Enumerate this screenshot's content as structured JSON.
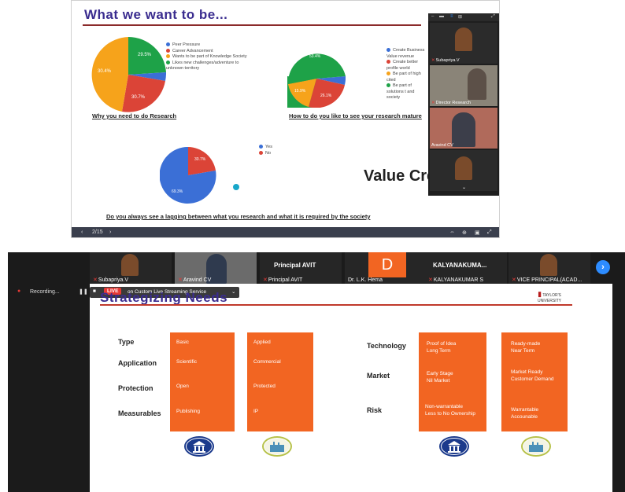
{
  "top_slide": {
    "title": "What we want to be...",
    "page_indicator": "2/15",
    "value_text": "Value Cre",
    "pie1": {
      "labels": [
        "29.5%",
        "30.4%",
        "30.7%"
      ],
      "legend": [
        "Peer Pressure",
        "Career Advancement",
        "Wants to be part of Knowledge Society",
        "Likes new challenges/adventure to unknown territory"
      ],
      "caption": "Why you need to do Research"
    },
    "pie2": {
      "labels": [
        "53.4%",
        "15.9%",
        "26.1%"
      ],
      "legend": [
        "Create Business Value revenue",
        "Create better profile world",
        "Be part of high cited",
        "Be part of solutions t and society"
      ],
      "caption": "How to do you like to see your research mature"
    },
    "pie3": {
      "labels": [
        "30.7%",
        "69.3%"
      ],
      "legend": [
        "Yes",
        "No"
      ],
      "caption": "Do you always see a lagging between what you research and what it is required by the society"
    },
    "colors": {
      "blue": "#3b6fd6",
      "red": "#db4437",
      "orange": "#f6a31b",
      "green": "#1ea248"
    }
  },
  "top_panel": {
    "participants": [
      "Subapriya.V",
      "Director Research",
      "Aravind CV",
      ""
    ]
  },
  "bottom_strip": {
    "participants": [
      "Subapriya.V",
      "Aravind CV",
      "Principal AVIT",
      "Dr. L.K. Hema",
      "KALYANAKUMAR S",
      "VICE PRINCIPAL(ACAD..."
    ],
    "principal_big": "Principal AVIT",
    "kalyan_big": "KALYANAKUMA...",
    "hema_initial": "D"
  },
  "recording": {
    "label": "Recording...",
    "live": "LIVE",
    "stream_text": "on Custom Live Streaming Service"
  },
  "slide2": {
    "title": "Strategizing Needs",
    "logo_text": "TAYLOR'S UNIVERSITY",
    "left_labels": [
      "Type",
      "Application",
      "Protection",
      "Measurables"
    ],
    "col1": [
      "Basic",
      "Scientific",
      "Open",
      "Publishing"
    ],
    "col2": [
      "Applied",
      "Commercial",
      "Protected",
      "IP"
    ],
    "right_labels": [
      "Technology",
      "Market",
      "Risk"
    ],
    "col3": [
      "Proof of Idea\nLong Term",
      "Early Stage\nNil Market",
      "Non-warrantable\nLess to No Ownership"
    ],
    "col4": [
      "Ready-made\nNear Term",
      "Market Ready\nCustomer Demand",
      "Warrantable\nAccounable"
    ],
    "icons": [
      "institution-icon",
      "factory-icon",
      "institution-icon",
      "factory-icon"
    ]
  }
}
